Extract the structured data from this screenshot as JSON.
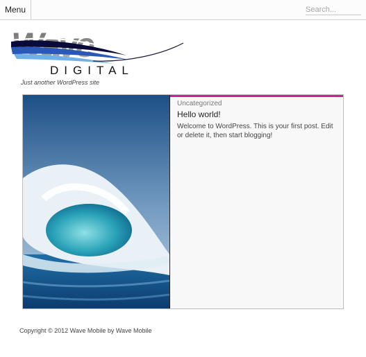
{
  "header": {
    "menu_label": "Menu",
    "search_placeholder": "Search..."
  },
  "site": {
    "logo_text": "Wave",
    "logo_subtext": "DIGITAL",
    "tagline": "Just another WordPress site"
  },
  "post": {
    "category": "Uncategorized",
    "title": "Hello world!",
    "excerpt": "Welcome to WordPress. This is your first post. Edit or delete it, then start blogging!",
    "accent_color": "#cc2299",
    "thumbnail_icon": "ocean-wave-image"
  },
  "footer": {
    "text": "Copyright © 2012 Wave Mobile by Wave Mobile"
  }
}
